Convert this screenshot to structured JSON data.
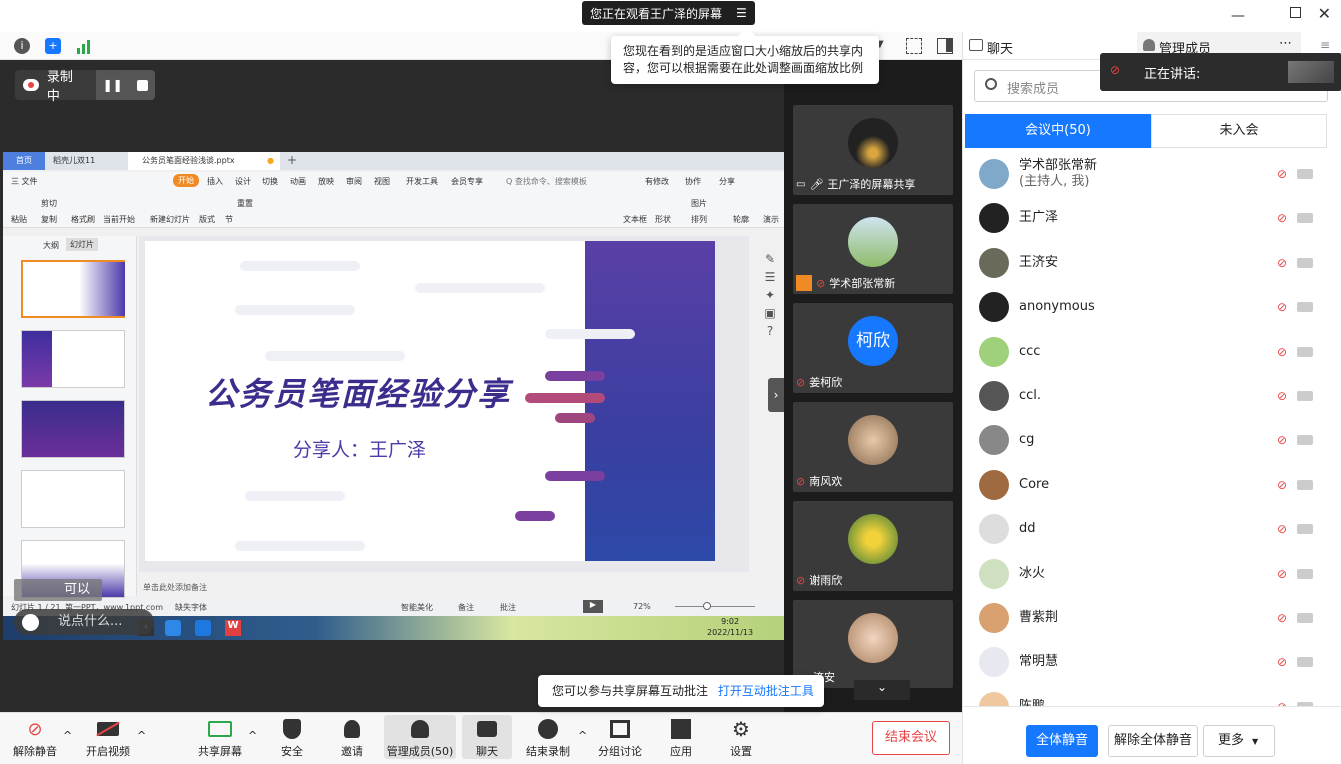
{
  "banner": {
    "text": "您正在观看王广泽的屏幕"
  },
  "tooltip_scale": {
    "text": "您现在看到的是适应窗口大小缩放后的共享内容，您可以根据需要在此处调整画面缩放比例"
  },
  "recording": {
    "label": "录制中"
  },
  "right_header": {
    "chat_label": "聊天",
    "members_label": "管理成员"
  },
  "speaking": {
    "label": "正在讲话:"
  },
  "search": {
    "placeholder": "搜索成员"
  },
  "member_tabs": {
    "in_meeting": "会议中(50)",
    "not_joined": "未入会"
  },
  "members": [
    {
      "name": "学术部张常新",
      "sub": "(主持人, 我)"
    },
    {
      "name": "王广泽"
    },
    {
      "name": "王济安"
    },
    {
      "name": "anonymous"
    },
    {
      "name": "ccc"
    },
    {
      "name": "ccl."
    },
    {
      "name": "cg"
    },
    {
      "name": "Core"
    },
    {
      "name": "dd"
    },
    {
      "name": "冰火"
    },
    {
      "name": "曹紫荆"
    },
    {
      "name": "常明慧"
    },
    {
      "name": "陈鹏"
    }
  ],
  "panel_buttons": {
    "mute_all": "全体静音",
    "unmute_all": "解除全体静音",
    "more": "更多"
  },
  "video_tiles": [
    {
      "name": "王广泽的屏幕共享"
    },
    {
      "name": "学术部张常新"
    },
    {
      "name": "姜柯欣",
      "initials": "柯欣"
    },
    {
      "name": "南风欢"
    },
    {
      "name": "谢雨欣"
    },
    {
      "name": "济安"
    }
  ],
  "ppt": {
    "tab_home": "首页",
    "tab_doc1": "稻壳儿双11",
    "tab_doc2": "公务员笔面经验浅谈.pptx",
    "menu": [
      "三 文件",
      "开始",
      "插入",
      "设计",
      "切换",
      "动画",
      "放映",
      "审阅",
      "视图",
      "开发工具",
      "会员专享"
    ],
    "search_cmd": "Q 查找命令、搜索模板",
    "right_menu": [
      "有修改",
      "协作",
      "分享"
    ],
    "ribbon": [
      "粘贴",
      "剪切",
      "复制",
      "格式刷",
      "当前开始",
      "新建幻灯片",
      "版式",
      "节",
      "重置",
      "文本框",
      "形状",
      "图片",
      "排列",
      "轮廓",
      "演示"
    ],
    "panel_tabs": [
      "大纲",
      "幻灯片"
    ],
    "slide_title": "公务员笔面经验分享",
    "slide_subtitle": "分享人：王广泽",
    "notes": "单击此处添加备注",
    "status_left": "幻灯片 1 / 21",
    "status_theme": "第一PPT，www.1ppt.com",
    "status_font": "缺失字体",
    "status_beauty": "智能美化",
    "status_notes": "备注",
    "status_comment": "批注",
    "zoom": "72%",
    "time": "9:02",
    "date": "2022/11/13"
  },
  "chat_overlay": {
    "placeholder": "说点什么...",
    "msg": "可以"
  },
  "annotate_tip": {
    "text": "您可以参与共享屏幕互动批注",
    "link": "打开互动批注工具"
  },
  "bottom": {
    "unmute": "解除静音",
    "video": "开启视频",
    "share": "共享屏幕",
    "security": "安全",
    "invite": "邀请",
    "members": "管理成员(50)",
    "chat": "聊天",
    "stop_rec": "结束录制",
    "breakout": "分组讨论",
    "apps": "应用",
    "settings": "设置",
    "end": "结束会议"
  },
  "colors": {
    "accent": "#1677ff",
    "end_red": "#e54545",
    "title_purple": "#3a2d8c"
  }
}
